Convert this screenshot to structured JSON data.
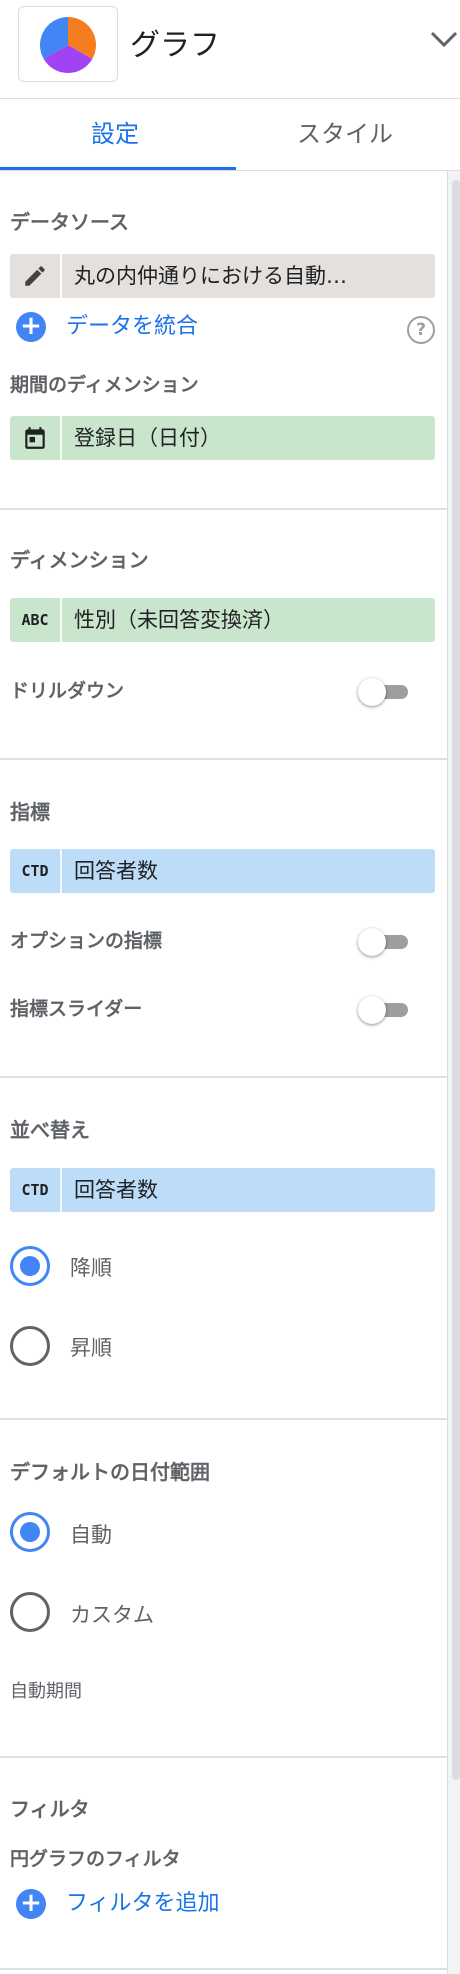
{
  "header": {
    "title": "グラフ",
    "logo_icon": "pie-chart-icon",
    "chevron_icon": "chevron-down-icon",
    "pie_colors": [
      "#f57c1f",
      "#a142f4",
      "#4285f4"
    ]
  },
  "tabs": [
    {
      "label": "設定",
      "active": true
    },
    {
      "label": "スタイル",
      "active": false
    }
  ],
  "data_source": {
    "title": "データソース",
    "value": "丸の内仲通りにおける自動…",
    "edit_icon": "pencil-icon",
    "blend_label": "データを統合",
    "help_icon": "help-circle-icon",
    "help_glyph": "?"
  },
  "date_dimension": {
    "title": "期間のディメンション",
    "value": "登録日（日付）",
    "icon": "calendar-icon"
  },
  "dimension": {
    "title": "ディメンション",
    "type_badge": "ABC",
    "value": "性別（未回答変換済）",
    "drilldown_label": "ドリルダウン",
    "drilldown_on": false
  },
  "metric": {
    "title": "指標",
    "type_badge": "CTD",
    "value": "回答者数",
    "optional_label": "オプションの指標",
    "optional_on": false,
    "slider_label": "指標スライダー",
    "slider_on": false
  },
  "sort": {
    "title": "並べ替え",
    "type_badge": "CTD",
    "value": "回答者数",
    "options": [
      "降順",
      "昇順"
    ],
    "selected": "降順"
  },
  "default_date_range": {
    "title": "デフォルトの日付範囲",
    "options": [
      "自動",
      "カスタム"
    ],
    "selected": "自動",
    "auto_period_label": "自動期間"
  },
  "filter": {
    "title": "フィルタ",
    "sub_title": "円グラフのフィルタ",
    "add_label": "フィルタを追加"
  },
  "colors": {
    "accent": "#1a73e8",
    "grey_chip": "#e3e0dd",
    "dimension_chip": "#c9e6cd",
    "metric_chip": "#bcdcf8"
  }
}
